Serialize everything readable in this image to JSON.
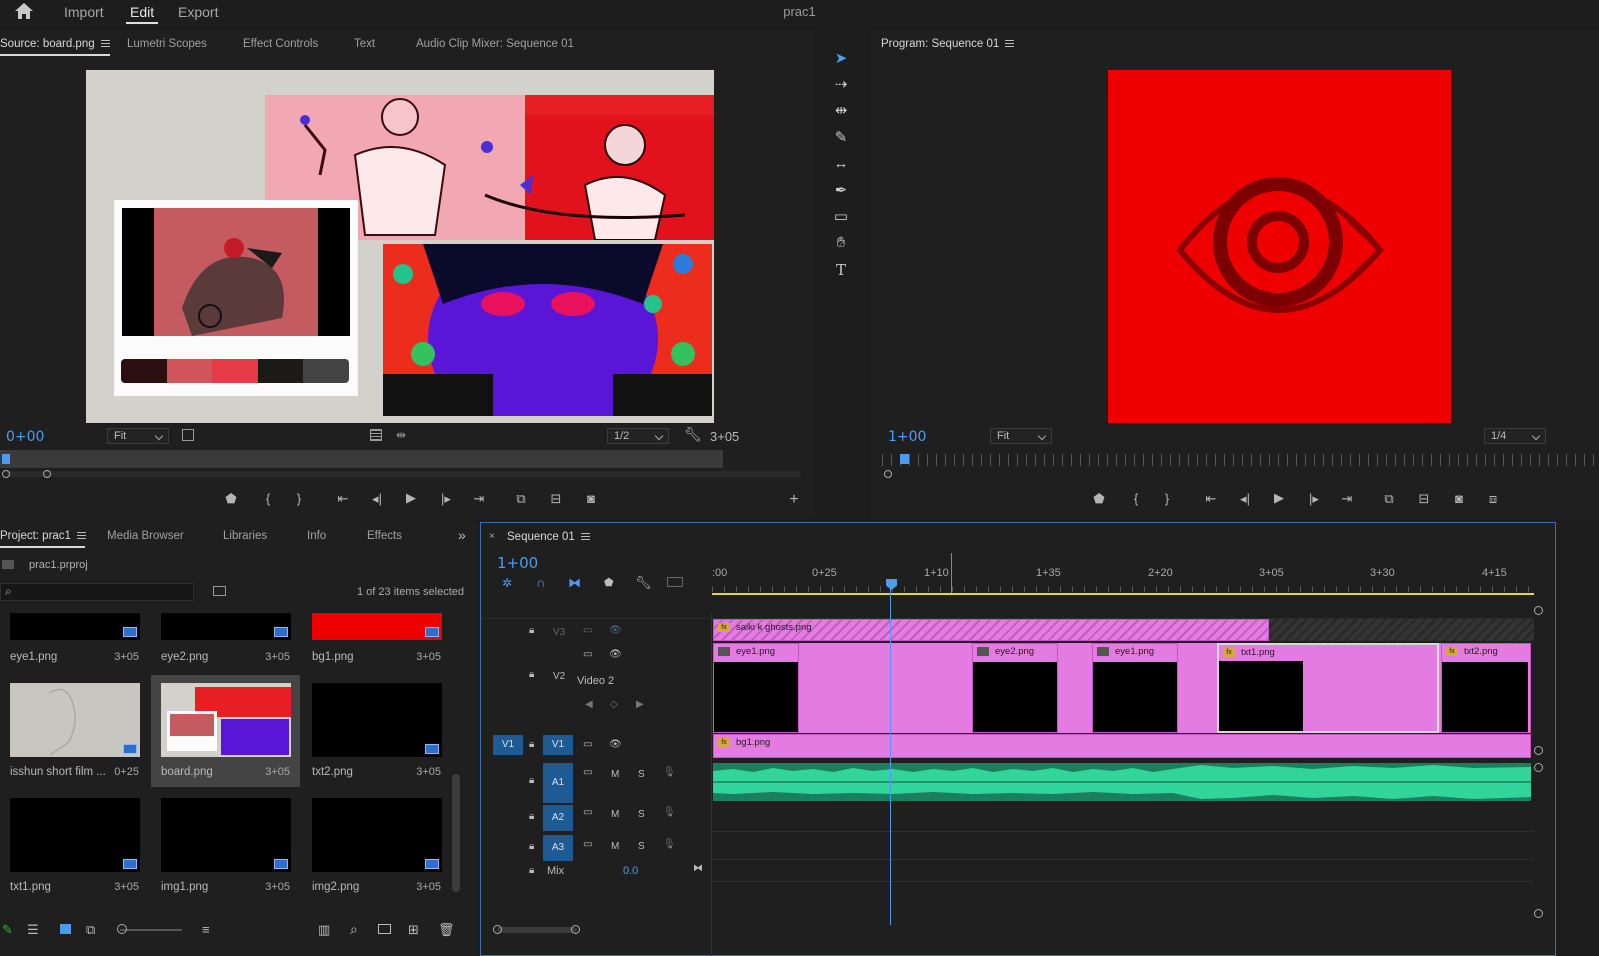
{
  "app": {
    "workspaces": [
      "Import",
      "Edit",
      "Export"
    ],
    "active_workspace": "Edit",
    "project_title": "prac1",
    "accent_color": "#4d9bf0"
  },
  "source_panel": {
    "tabs": [
      "Source: board.png",
      "Lumetri Scopes",
      "Effect Controls",
      "Text",
      "Audio Clip Mixer: Sequence 01"
    ],
    "active_tab": "Source: board.png",
    "timecode_in": "0+00",
    "timecode_duration": "3+05",
    "zoom": "Fit",
    "resolution": "1/2"
  },
  "program_panel": {
    "title": "Program: Sequence 01",
    "timecode": "1+00",
    "zoom": "Fit",
    "resolution": "1/4",
    "frame_color": "#ee0000"
  },
  "tools": [
    "selection-tool",
    "track-select-tool",
    "ripple-edit-tool",
    "razor-tool",
    "slip-tool",
    "pen-tool",
    "rectangle-tool",
    "hand-tool",
    "type-tool"
  ],
  "project_panel": {
    "tabs": [
      "Project: prac1",
      "Media Browser",
      "Libraries",
      "Info",
      "Effects"
    ],
    "active_tab": "Project: prac1",
    "file_name": "prac1.prproj",
    "search_placeholder": "",
    "selection_status": "1 of 23 items selected",
    "items": [
      {
        "name": "eye1.png",
        "duration": "3+05"
      },
      {
        "name": "eye2.png",
        "duration": "3+05"
      },
      {
        "name": "bg1.png",
        "duration": "3+05"
      },
      {
        "name": "isshun short film ...",
        "duration": "0+25"
      },
      {
        "name": "board.png",
        "duration": "3+05"
      },
      {
        "name": "txt2.png",
        "duration": "3+05"
      },
      {
        "name": "txt1.png",
        "duration": "3+05"
      },
      {
        "name": "img1.png",
        "duration": "3+05"
      },
      {
        "name": "img2.png",
        "duration": "3+05"
      }
    ]
  },
  "timeline": {
    "tab": "Sequence 01",
    "timecode": "1+00",
    "ruler_labels": [
      ":00",
      "0+25",
      "1+10",
      "1+35",
      "2+20",
      "3+05",
      "3+30",
      "4+15"
    ],
    "tracks": {
      "v3": "V3",
      "v2": "V2",
      "v2_name": "Video 2",
      "v1_src": "V1",
      "v1": "V1",
      "a1": "A1",
      "a2": "A2",
      "a3": "A3",
      "mute": "M",
      "solo": "S",
      "mix_label": "Mix",
      "mix_value": "0.0"
    },
    "clips": {
      "v3": "saiki k ghosts.png",
      "v2_1": "eye1.png",
      "v2_2": "eye2.png",
      "v2_3": "eye1.png",
      "v2_4": "txt1.png",
      "v2_5": "txt2.png",
      "v1": "bg1.png"
    }
  }
}
